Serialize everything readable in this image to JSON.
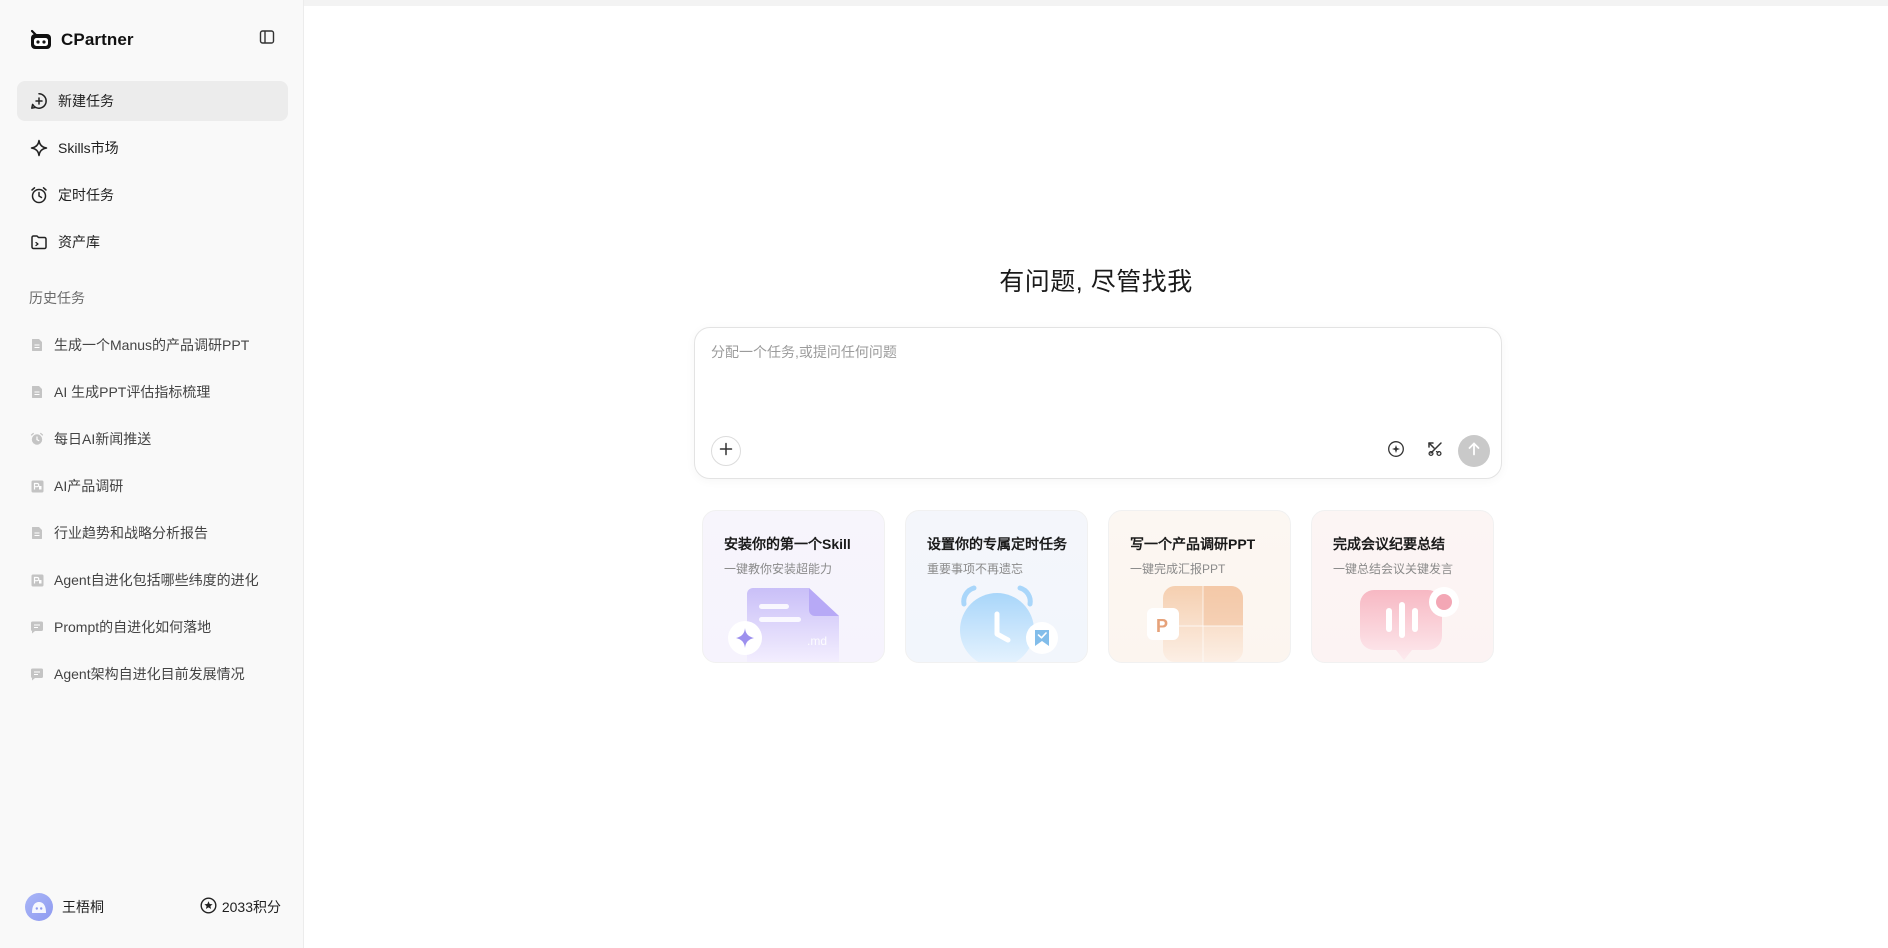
{
  "app": {
    "name": "CPartner"
  },
  "sidebar": {
    "nav": [
      {
        "label": "新建任务",
        "icon": "new-task-icon"
      },
      {
        "label": "Skills市场",
        "icon": "sparkle-icon"
      },
      {
        "label": "定时任务",
        "icon": "alarm-clock-icon"
      },
      {
        "label": "资产库",
        "icon": "folder-icon"
      }
    ],
    "history_title": "历史任务",
    "history": [
      {
        "label": "生成一个Manus的产品调研PPT",
        "icon": "document-icon"
      },
      {
        "label": "AI 生成PPT评估指标梳理",
        "icon": "document-icon"
      },
      {
        "label": "每日AI新闻推送",
        "icon": "alarm-clock-icon"
      },
      {
        "label": "AI产品调研",
        "icon": "slides-icon"
      },
      {
        "label": "行业趋势和战略分析报告",
        "icon": "document-icon"
      },
      {
        "label": "Agent自进化包括哪些纬度的进化",
        "icon": "slides-icon"
      },
      {
        "label": "Prompt的自进化如何落地",
        "icon": "chat-icon"
      },
      {
        "label": "Agent架构自进化目前发展情况",
        "icon": "chat-icon"
      }
    ],
    "user": {
      "name": "王梧桐",
      "points": "2033积分"
    }
  },
  "main": {
    "headline": "有问题, 尽管找我",
    "composer": {
      "placeholder": "分配一个任务,或提问任何问题",
      "value": ""
    },
    "cards": [
      {
        "title": "安装你的第一个Skill",
        "subtitle": "一键教你安装超能力",
        "illu_text": ".md"
      },
      {
        "title": "设置你的专属定时任务",
        "subtitle": "重要事项不再遗忘"
      },
      {
        "title": "写一个产品调研PPT",
        "subtitle": "一键完成汇报PPT",
        "illu_text": "P"
      },
      {
        "title": "完成会议纪要总结",
        "subtitle": "一键总结会议关键发言"
      }
    ]
  },
  "colors": {
    "sidebar_bg": "#f9f9f9",
    "active_item_bg": "#ececec",
    "send_button": "#c9c9c9",
    "card_purple": "#f6f3fd",
    "card_blue": "#f2f6fc",
    "card_orange": "#fcf5ef",
    "card_pink": "#fcf3f3"
  }
}
